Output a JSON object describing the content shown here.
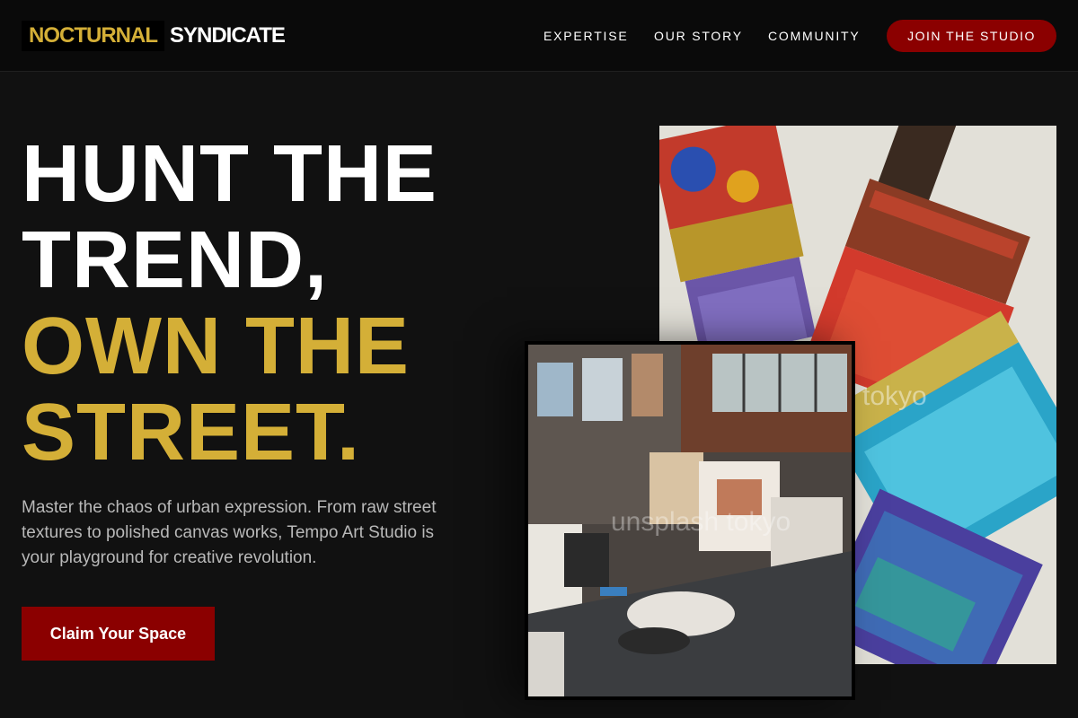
{
  "brand": {
    "part1": "NOCTURNAL",
    "part2": "SYNDICATE"
  },
  "nav": {
    "items": [
      "EXPERTISE",
      "OUR STORY",
      "COMMUNITY"
    ],
    "join_label": "JOIN THE STUDIO"
  },
  "hero": {
    "headline_white_1": "HUNT THE",
    "headline_white_2": "TREND,",
    "headline_gold_1": "OWN THE",
    "headline_gold_2": "STREET.",
    "lede": "Master the chaos of urban expression. From raw street textures to polished canvas works, Tempo Art Studio is your playground for creative revolution.",
    "cta_label": "Claim Your Space"
  },
  "watermarks": {
    "brushes": "tokyo",
    "studio": "unsplash tokyo"
  },
  "colors": {
    "accent_gold": "#d4af37",
    "accent_red": "#8b0000",
    "background": "#111111"
  }
}
